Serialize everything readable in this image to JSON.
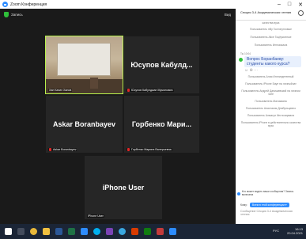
{
  "window": {
    "title": "Zoom Конференция",
    "minimize": "–",
    "maximize": "□",
    "close": "✕"
  },
  "toolbar": {
    "recording_label": "Запись",
    "view_label": "Вид"
  },
  "tiles": [
    {
      "center_name": "",
      "footer_name": "Хан Канат Ханов"
    },
    {
      "center_name": "Юсупов Кабулд...",
      "footer_name": "Юсупов Кабулджан Муминович"
    },
    {
      "center_name": "Askar Boranbayev",
      "footer_name": "Askar Boranbayev"
    },
    {
      "center_name": "Горбенко Мари...",
      "footer_name": "Горбенко Марина Валерьевна"
    },
    {
      "center_name": "iPhone User",
      "footer_name": "iPhone User"
    }
  ],
  "chat": {
    "header_title": "Секция 3-4 Академическая чтения",
    "top_note": "качества вуза",
    "system_messages_top": [
      "Пользователь нBy Гостинунговые",
      "Пользователь Alice Гоцёрконные",
      "Пользователь Инглазиала"
    ],
    "sender": "Ты  10:04",
    "question": "Вопрос Боранбаеву: студенты какого курса?",
    "reactions": "☺ ⊕ ···",
    "system_messages_bottom": [
      "Пользователь Алия Инглитдетенный",
      "Пользователь iPhone Бауе на личныйчат ",
      "Пользователь Андрей Данишевский на личном чате",
      "Пользователь Магзамана",
      "Пользователь Анастасия Длибульцевно",
      "Пользователь Алмагул Инглозирвала",
      "Пользователь iPhone в действительно качества вуза"
    ],
    "ack_text": "Кто может видеть ваши сообщения? Запись включена",
    "to_label": "Кому:",
    "to_value": "Всем в этой конференции ▾",
    "compose_placeholder": "Сообщение Секция 3-4 Академическая чтения"
  },
  "taskbar": {
    "time": "16:13",
    "date": "20.04.2021",
    "lang": "РУС",
    "apps": [
      "windows",
      "search",
      "chrome",
      "folder",
      "word",
      "excel",
      "zoom",
      "skype",
      "app",
      "telegram",
      "app2",
      "app3",
      "app4"
    ]
  },
  "colors": {
    "zoom_blue": "#2D8CFF",
    "active_speaker": "#b8f04c",
    "mic_off": "#e02828"
  }
}
